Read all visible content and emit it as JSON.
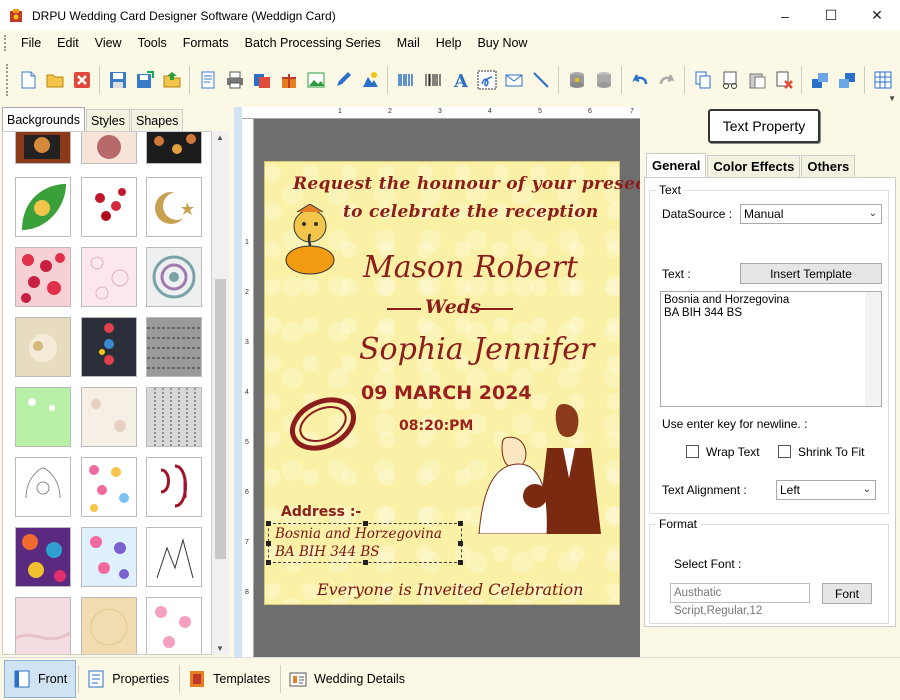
{
  "window": {
    "title": "DRPU Wedding Card Designer Software (Weddign Card)",
    "minimize": "–",
    "maximize": "☐",
    "close": "✕"
  },
  "menu": [
    "File",
    "Edit",
    "View",
    "Tools",
    "Formats",
    "Batch Processing Series",
    "Mail",
    "Help",
    "Buy Now"
  ],
  "toolbar_icons": [
    "new-file-icon",
    "open-folder-icon",
    "close-icon",
    "save-icon",
    "save-as-icon",
    "export-icon",
    "properties-icon",
    "print-icon",
    "print-preview-icon",
    "gift-icon",
    "image-icon",
    "pen-icon",
    "shape-icon",
    "barcode-icon",
    "barcode2-icon",
    "text-icon",
    "signature-icon",
    "email-icon",
    "line-icon",
    "database-icon",
    "database2-icon",
    "undo-icon",
    "redo-icon",
    "copy-icon",
    "cut-icon",
    "paste-icon",
    "delete-icon",
    "bring-front-icon",
    "send-back-icon",
    "grid-icon"
  ],
  "left_panel": {
    "tabs": [
      "Backgrounds",
      "Styles",
      "Shapes"
    ],
    "active_tab": "Backgrounds"
  },
  "card": {
    "line1": "Request the hounour of your presece",
    "line2": "to celebrate the reception",
    "groom": "Mason Robert",
    "weds": "Weds",
    "bride": "Sophia Jennifer",
    "date": "09 MARCH 2024",
    "time": "08:20:PM",
    "address_label": "Address :-",
    "address_line1": "Bosnia and Horzegovina",
    "address_line2": "BA BIH 344 BS",
    "footer": "Everyone is Inveited Celebration"
  },
  "ruler": {
    "top": [
      "1",
      "2",
      "3",
      "4",
      "5",
      "6",
      "7"
    ],
    "left": [
      "1",
      "2",
      "3",
      "4",
      "5",
      "6",
      "7",
      "8"
    ]
  },
  "right_panel": {
    "property_button": "Text Property",
    "tabs": [
      "General",
      "Color Effects",
      "Others"
    ],
    "text_group": "Text",
    "datasource_label": "DataSource :",
    "datasource_value": "Manual",
    "text_label": "Text :",
    "insert_template": "Insert Template",
    "text_value_line1": "Bosnia and Horzegovina",
    "text_value_line2": "BA BIH 344 BS",
    "newline_hint": "Use enter key for newline. :",
    "wrap_text": "Wrap Text",
    "shrink_to_fit": "Shrink To Fit",
    "alignment_label": "Text Alignment :",
    "alignment_value": "Left",
    "format_group": "Format",
    "select_font_label": "Select Font :",
    "font_value": "Austhatic Script,Regular,12",
    "font_button": "Font"
  },
  "bottom_bar": [
    "Front",
    "Properties",
    "Templates",
    "Wedding Details"
  ]
}
